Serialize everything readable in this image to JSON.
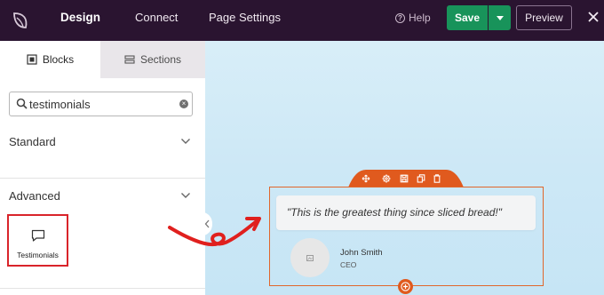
{
  "topbar": {
    "tabs": [
      "Design",
      "Connect",
      "Page Settings"
    ],
    "help_label": "Help",
    "save_label": "Save",
    "preview_label": "Preview"
  },
  "sidebar": {
    "tabs": [
      "Blocks",
      "Sections"
    ],
    "search": {
      "value": "testimonials"
    },
    "sections": [
      {
        "title": "Standard"
      },
      {
        "title": "Advanced",
        "blocks": [
          {
            "label": "Testimonials",
            "icon": "speech-bubble-icon",
            "highlighted": true
          }
        ]
      }
    ]
  },
  "canvas": {
    "toolbar_icons": [
      "move-icon",
      "gear-icon",
      "save-icon",
      "duplicate-icon",
      "trash-icon"
    ],
    "testimonial": {
      "quote": "\"This is the greatest thing since sliced bread!\"",
      "name": "John Smith",
      "role": "CEO"
    },
    "add_icon": "plus-circle-icon"
  },
  "colors": {
    "topbar_bg": "#2a1430",
    "save_green": "#18935a",
    "highlight_red": "#d9242a",
    "accent_orange": "#e05a1e",
    "canvas_bg": "#cfe9f6"
  }
}
